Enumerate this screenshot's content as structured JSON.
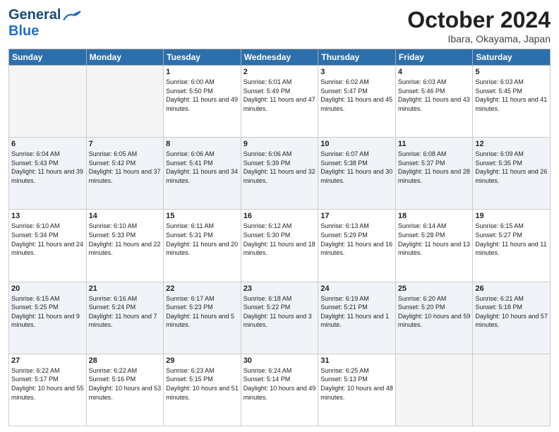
{
  "header": {
    "logo_general": "General",
    "logo_blue": "Blue",
    "month": "October 2024",
    "location": "Ibara, Okayama, Japan"
  },
  "days_of_week": [
    "Sunday",
    "Monday",
    "Tuesday",
    "Wednesday",
    "Thursday",
    "Friday",
    "Saturday"
  ],
  "weeks": [
    [
      {
        "day": "",
        "info": ""
      },
      {
        "day": "",
        "info": ""
      },
      {
        "day": "1",
        "info": "Sunrise: 6:00 AM\nSunset: 5:50 PM\nDaylight: 11 hours and 49 minutes."
      },
      {
        "day": "2",
        "info": "Sunrise: 6:01 AM\nSunset: 5:49 PM\nDaylight: 11 hours and 47 minutes."
      },
      {
        "day": "3",
        "info": "Sunrise: 6:02 AM\nSunset: 5:47 PM\nDaylight: 11 hours and 45 minutes."
      },
      {
        "day": "4",
        "info": "Sunrise: 6:03 AM\nSunset: 5:46 PM\nDaylight: 11 hours and 43 minutes."
      },
      {
        "day": "5",
        "info": "Sunrise: 6:03 AM\nSunset: 5:45 PM\nDaylight: 11 hours and 41 minutes."
      }
    ],
    [
      {
        "day": "6",
        "info": "Sunrise: 6:04 AM\nSunset: 5:43 PM\nDaylight: 11 hours and 39 minutes."
      },
      {
        "day": "7",
        "info": "Sunrise: 6:05 AM\nSunset: 5:42 PM\nDaylight: 11 hours and 37 minutes."
      },
      {
        "day": "8",
        "info": "Sunrise: 6:06 AM\nSunset: 5:41 PM\nDaylight: 11 hours and 34 minutes."
      },
      {
        "day": "9",
        "info": "Sunrise: 6:06 AM\nSunset: 5:39 PM\nDaylight: 11 hours and 32 minutes."
      },
      {
        "day": "10",
        "info": "Sunrise: 6:07 AM\nSunset: 5:38 PM\nDaylight: 11 hours and 30 minutes."
      },
      {
        "day": "11",
        "info": "Sunrise: 6:08 AM\nSunset: 5:37 PM\nDaylight: 11 hours and 28 minutes."
      },
      {
        "day": "12",
        "info": "Sunrise: 6:09 AM\nSunset: 5:35 PM\nDaylight: 11 hours and 26 minutes."
      }
    ],
    [
      {
        "day": "13",
        "info": "Sunrise: 6:10 AM\nSunset: 5:34 PM\nDaylight: 11 hours and 24 minutes."
      },
      {
        "day": "14",
        "info": "Sunrise: 6:10 AM\nSunset: 5:33 PM\nDaylight: 11 hours and 22 minutes."
      },
      {
        "day": "15",
        "info": "Sunrise: 6:11 AM\nSunset: 5:31 PM\nDaylight: 11 hours and 20 minutes."
      },
      {
        "day": "16",
        "info": "Sunrise: 6:12 AM\nSunset: 5:30 PM\nDaylight: 11 hours and 18 minutes."
      },
      {
        "day": "17",
        "info": "Sunrise: 6:13 AM\nSunset: 5:29 PM\nDaylight: 11 hours and 16 minutes."
      },
      {
        "day": "18",
        "info": "Sunrise: 6:14 AM\nSunset: 5:28 PM\nDaylight: 11 hours and 13 minutes."
      },
      {
        "day": "19",
        "info": "Sunrise: 6:15 AM\nSunset: 5:27 PM\nDaylight: 11 hours and 11 minutes."
      }
    ],
    [
      {
        "day": "20",
        "info": "Sunrise: 6:15 AM\nSunset: 5:25 PM\nDaylight: 11 hours and 9 minutes."
      },
      {
        "day": "21",
        "info": "Sunrise: 6:16 AM\nSunset: 5:24 PM\nDaylight: 11 hours and 7 minutes."
      },
      {
        "day": "22",
        "info": "Sunrise: 6:17 AM\nSunset: 5:23 PM\nDaylight: 11 hours and 5 minutes."
      },
      {
        "day": "23",
        "info": "Sunrise: 6:18 AM\nSunset: 5:22 PM\nDaylight: 11 hours and 3 minutes."
      },
      {
        "day": "24",
        "info": "Sunrise: 6:19 AM\nSunset: 5:21 PM\nDaylight: 11 hours and 1 minute."
      },
      {
        "day": "25",
        "info": "Sunrise: 6:20 AM\nSunset: 5:20 PM\nDaylight: 10 hours and 59 minutes."
      },
      {
        "day": "26",
        "info": "Sunrise: 6:21 AM\nSunset: 5:18 PM\nDaylight: 10 hours and 57 minutes."
      }
    ],
    [
      {
        "day": "27",
        "info": "Sunrise: 6:22 AM\nSunset: 5:17 PM\nDaylight: 10 hours and 55 minutes."
      },
      {
        "day": "28",
        "info": "Sunrise: 6:22 AM\nSunset: 5:16 PM\nDaylight: 10 hours and 53 minutes."
      },
      {
        "day": "29",
        "info": "Sunrise: 6:23 AM\nSunset: 5:15 PM\nDaylight: 10 hours and 51 minutes."
      },
      {
        "day": "30",
        "info": "Sunrise: 6:24 AM\nSunset: 5:14 PM\nDaylight: 10 hours and 49 minutes."
      },
      {
        "day": "31",
        "info": "Sunrise: 6:25 AM\nSunset: 5:13 PM\nDaylight: 10 hours and 48 minutes."
      },
      {
        "day": "",
        "info": ""
      },
      {
        "day": "",
        "info": ""
      }
    ]
  ]
}
